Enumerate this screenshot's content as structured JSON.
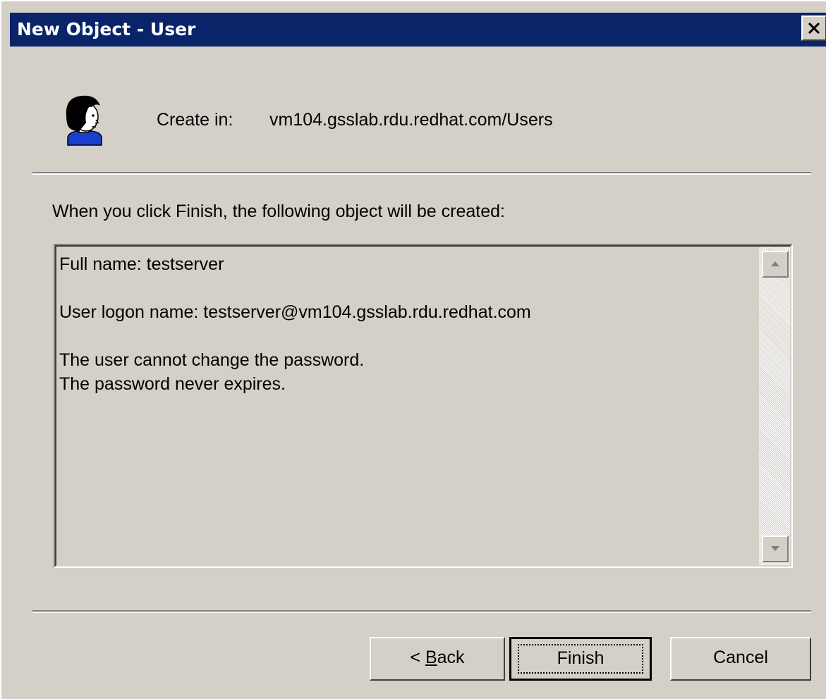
{
  "window": {
    "title": "New Object - User",
    "close_glyph": "✕"
  },
  "header": {
    "icon": "user-icon",
    "create_in_label": "Create in:",
    "create_in_path": "vm104.gsslab.rdu.redhat.com/Users"
  },
  "intro_text": "When you click Finish, the following object will be created:",
  "summary": {
    "full_name_line": "Full name: testserver",
    "logon_name_line": "User logon name: testserver@vm104.gsslab.rdu.redhat.com",
    "password_change_line": "The user cannot change the password.",
    "password_expire_line": "The password never expires."
  },
  "buttons": {
    "back_prefix": "< ",
    "back_underlined": "B",
    "back_rest": "ack",
    "finish": "Finish",
    "cancel": "Cancel"
  },
  "colors": {
    "title_bar": "#0a246a",
    "dialog_face": "#d4d0c8"
  }
}
